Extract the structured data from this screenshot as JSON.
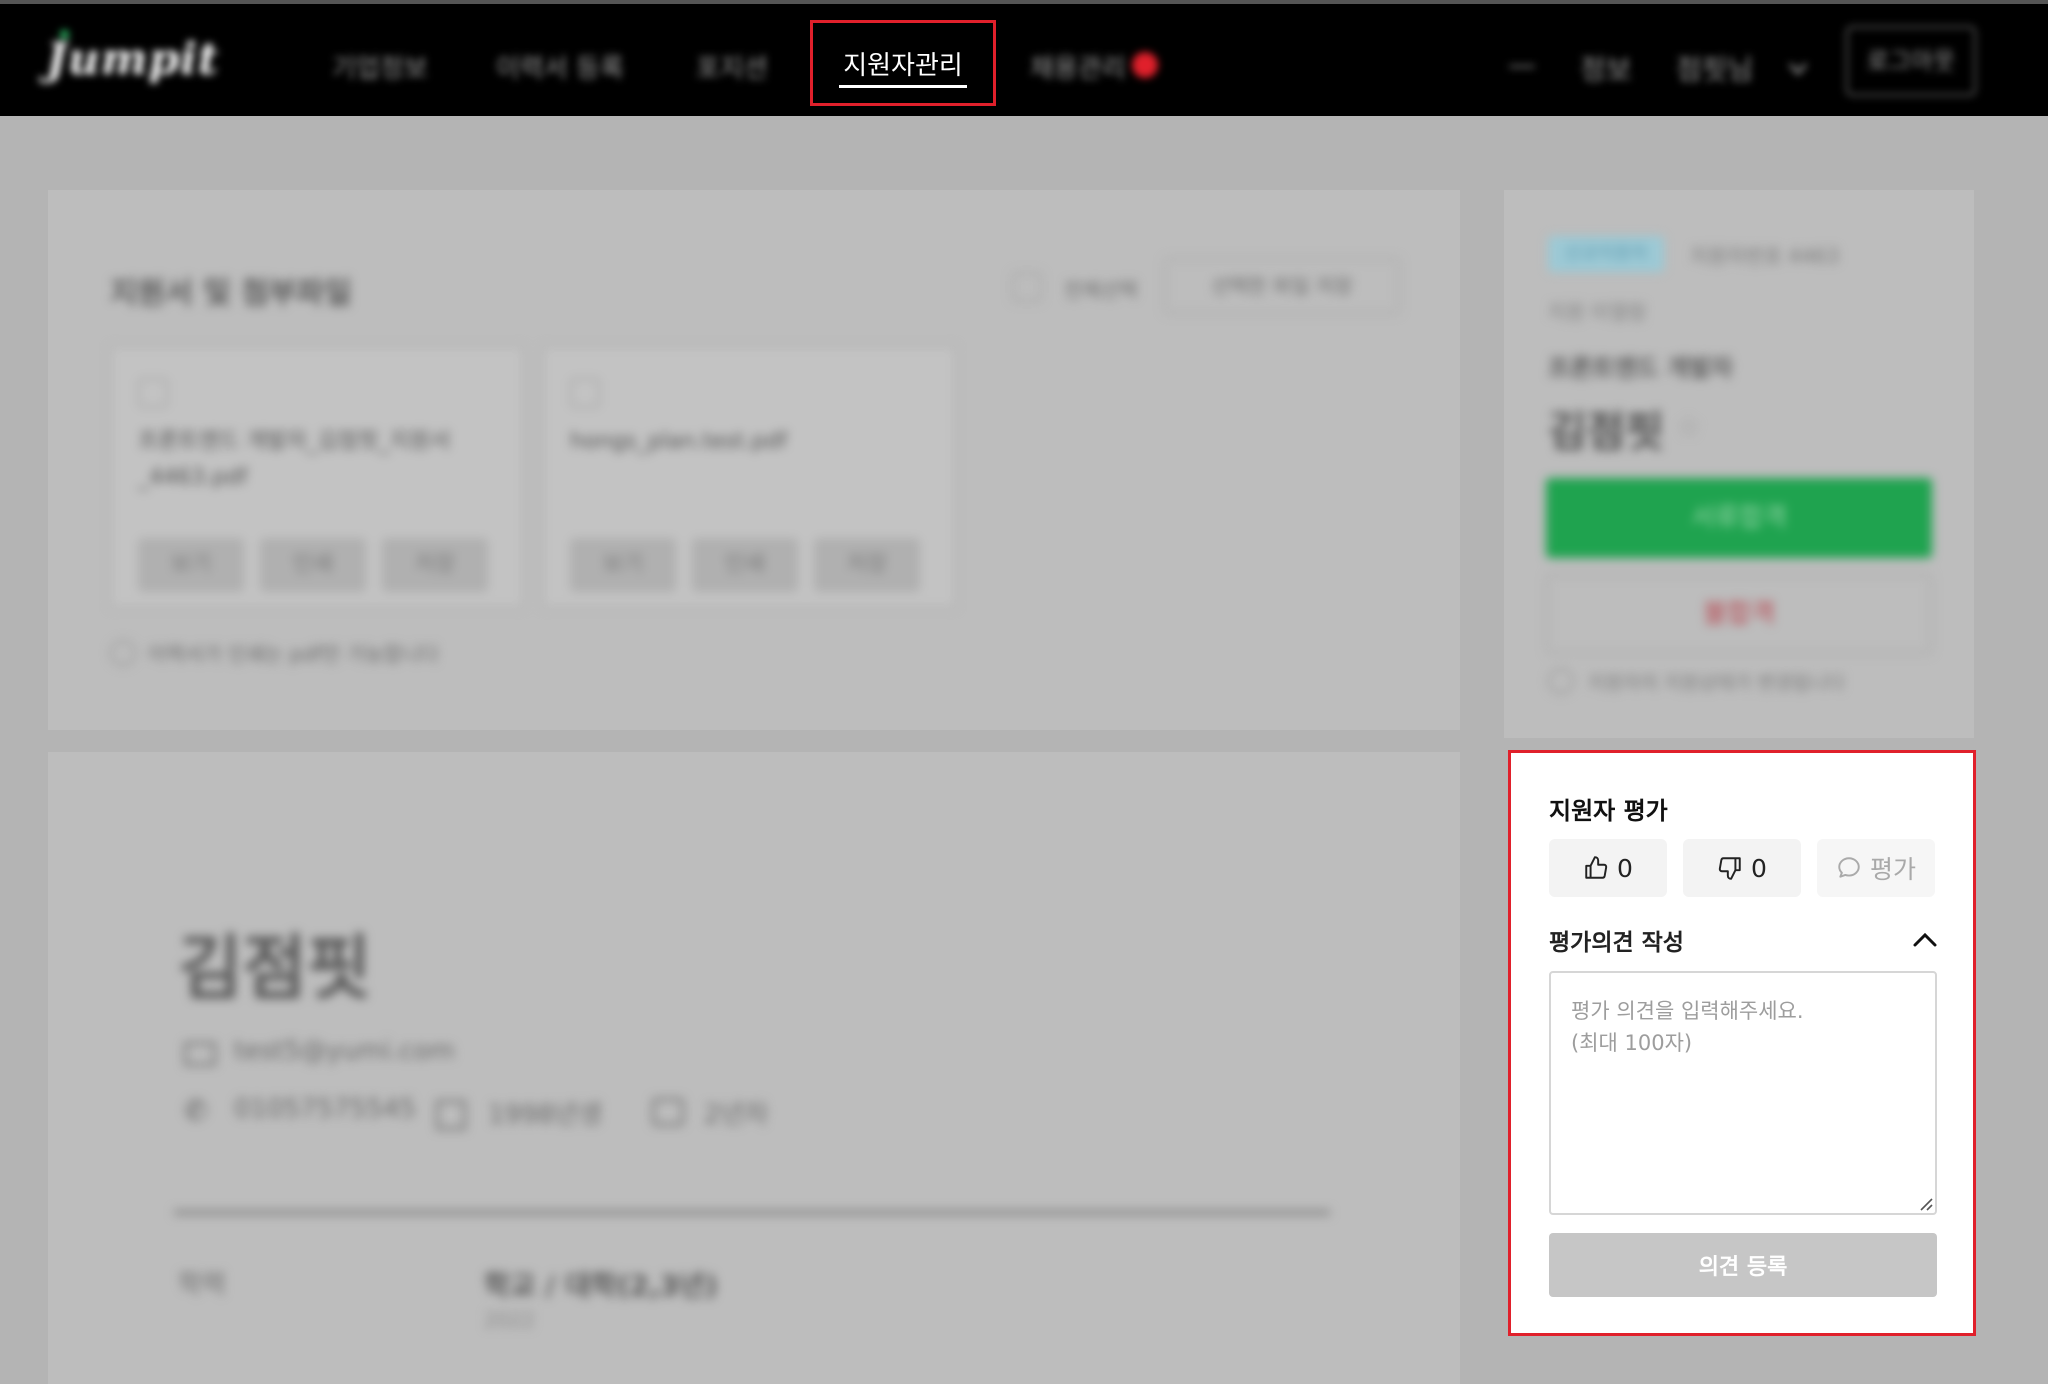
{
  "nav": {
    "logo": "Jumpit",
    "items": [
      "기업정보",
      "이력서 등록",
      "포지션",
      "지원자관리",
      "채용관리"
    ],
    "right_items": [
      "—",
      "정보",
      "점핏님",
      "로그아웃"
    ]
  },
  "documents": {
    "title": "지원서 및 첨부파일",
    "select_all": "전체선택",
    "download_selected": "선택한 파일 저장",
    "files": [
      {
        "name": "프론트엔드 개발자_김점핏_지원서_4463.pdf"
      },
      {
        "name": "hongs_plan.test.pdf"
      }
    ],
    "actions": [
      "보기",
      "인쇄",
      "저장"
    ],
    "note": "이력서가 인쇄는 pdf만 가능합니다"
  },
  "applicant": {
    "tag": "신규지원자",
    "applicant_no": "지원자번호 4463",
    "status_select": "지원 미열람",
    "position": "프론트엔드 개발자",
    "name": "김점핏",
    "pass_label": "서류합격",
    "reject_label": "불합격",
    "status_note": "지원자의 지원상태가 변경됩니다",
    "email": "test5@yumi.com",
    "phone": "01057575545",
    "birth": "1998년생",
    "career": "2년차",
    "edu_label": "학력",
    "edu_value": "학교 / 대학(2,3년)",
    "edu_year": "2022"
  },
  "evaluation": {
    "title": "지원자 평가",
    "like_count": "0",
    "dislike_count": "0",
    "comment_label": "평가",
    "opinion_title": "평가의견 작성",
    "placeholder": "평가 의견을 입력해주세요.\n(최대 100자)",
    "submit_label": "의견 등록"
  }
}
